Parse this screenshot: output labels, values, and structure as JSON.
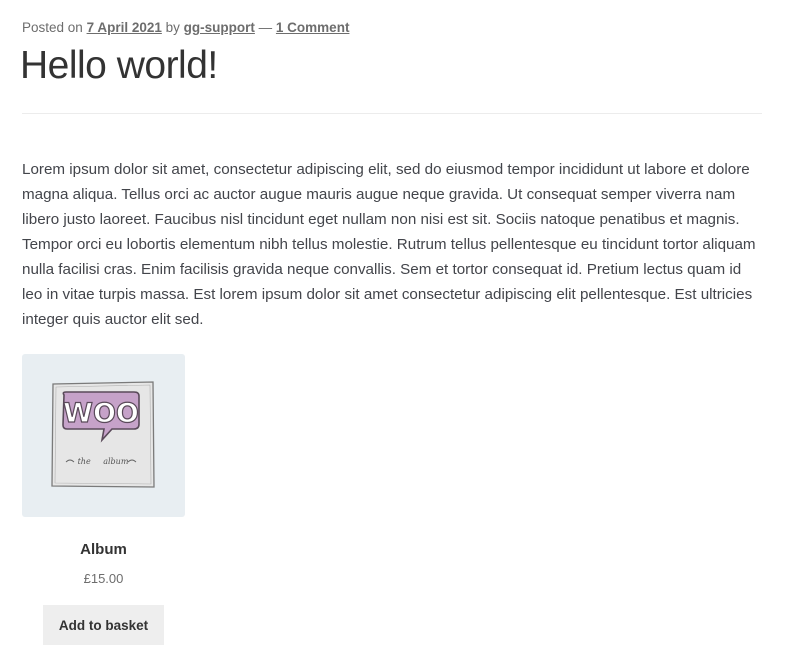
{
  "post": {
    "meta": {
      "posted_on_label": "Posted on",
      "date": "7 April 2021",
      "by_label": "by",
      "author": "gg-support",
      "separator": "—",
      "comments": "1 Comment"
    },
    "title": "Hello world!",
    "body": "Lorem ipsum dolor sit amet, consectetur adipiscing elit, sed do eiusmod tempor incididunt ut labore et dolore magna aliqua. Tellus orci ac auctor augue mauris augue neque gravida. Ut consequat semper viverra nam libero justo laoreet. Faucibus nisl tincidunt eget nullam non nisi est sit. Sociis natoque penatibus et magnis. Tempor orci eu lobortis elementum nibh tellus molestie. Rutrum tellus pellentesque eu tincidunt tortor aliquam nulla facilisi cras. Enim facilisis gravida neque convallis. Sem et tortor consequat id. Pretium lectus quam id leo in vitae turpis massa. Est lorem ipsum dolor sit amet consectetur adipiscing elit pellentesque. Est ultricies integer quis auctor elit sed."
  },
  "product": {
    "name": "Album",
    "price": "£15.00",
    "add_to_basket_label": "Add to basket",
    "image": {
      "logo_text": "WOO",
      "caption": "the album",
      "logo_color": "#c6a2c9"
    }
  }
}
